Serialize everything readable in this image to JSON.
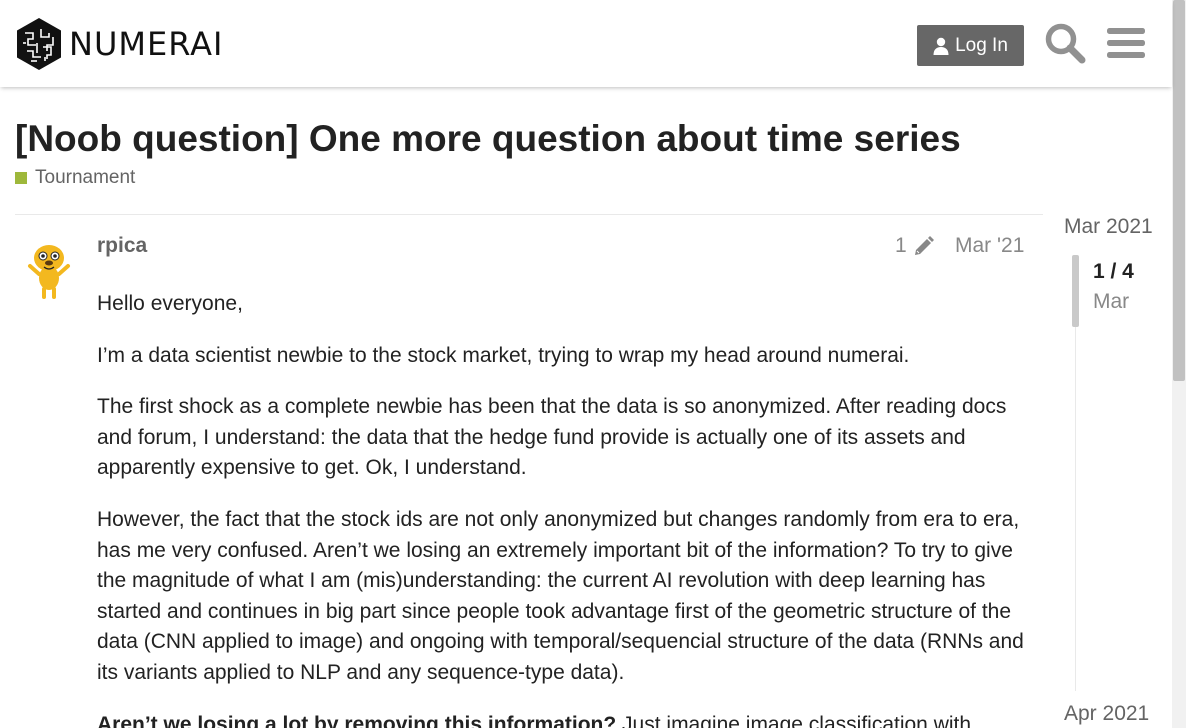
{
  "header": {
    "brand": "NUMERAI",
    "login_label": "Log In"
  },
  "topic": {
    "title": "[Noob question] One more question about time series",
    "category": "Tournament",
    "category_color": "#9eb83b"
  },
  "post": {
    "username": "rpica",
    "edit_count": "1",
    "date": "Mar '21",
    "paragraphs": [
      "Hello everyone,",
      "I’m a data scientist newbie to the stock market, trying to wrap my head around numerai.",
      "The first shock as a complete newbie has been that the data is so anonymized. After reading docs and forum, I understand: the data that the hedge fund provide is actually one of its assets and apparently expensive to get. Ok, I understand.",
      "However, the fact that the stock ids are not only anonymized but changes randomly from era to era, has me very confused. Aren’t we losing an extremely important bit of the information? To try to give the magnitude of what I am (mis)understanding: the current AI revolution with deep learning has started and continues in big part since people took advantage first of the geometric structure of the data (CNN applied to image) and ongoing with temporal/sequencial structure of the data (RNNs and its variants applied to NLP and any sequence-type data)."
    ],
    "last_paragraph_bold": "Aren’t we losing a lot by removing this information?",
    "last_paragraph_rest": " Just imagine image classification with"
  },
  "timeline": {
    "top_date": "Mar 2021",
    "counter": "1 / 4",
    "month": "Mar",
    "bottom_date": "Apr 2021"
  }
}
